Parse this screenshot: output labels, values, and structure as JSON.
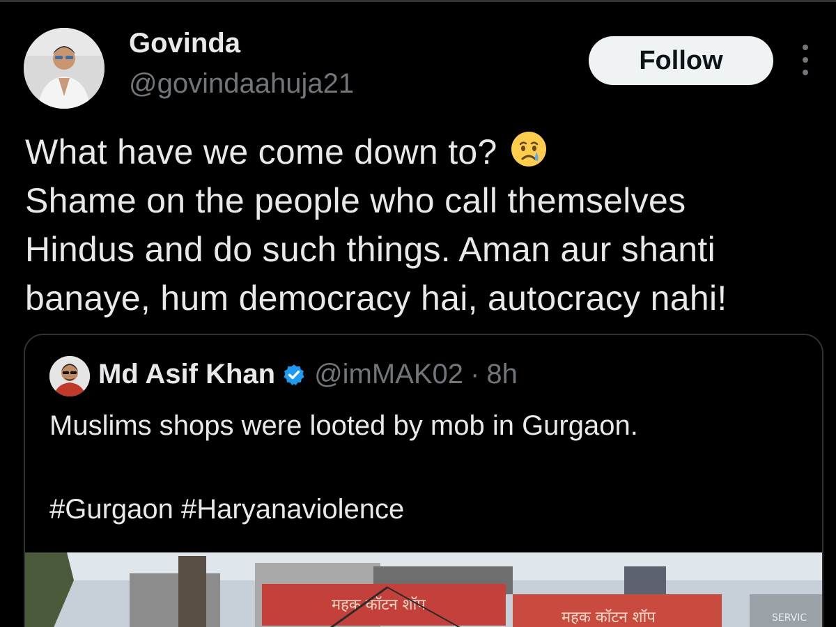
{
  "author": {
    "name": "Govinda",
    "handle": "@govindaahuja21",
    "follow_label": "Follow"
  },
  "tweet": {
    "lines": [
      "What have we come down to?",
      "Shame on the people who call themselves",
      "Hindus and do such things. Aman aur shanti",
      "banaye, hum democracy hai, autocracy nahi!"
    ],
    "emoji": "crying-face-icon"
  },
  "quoted": {
    "name": "Md Asif Khan",
    "handle": "@imMAK02",
    "separator": "·",
    "time": "8h",
    "text": "Muslims shops were looted by mob in Gurgaon.",
    "hashtags": "#Gurgaon #Haryanaviolence",
    "media_signs": [
      "महक कॉटन शॉप",
      "महक कॉटन शॉप",
      "SERVIC"
    ]
  },
  "colors": {
    "background": "#000000",
    "text": "#e7e9ea",
    "secondary": "#71767b",
    "border": "#2f3336",
    "verified": "#1d9bf0",
    "follow_bg": "#eff3f4"
  }
}
